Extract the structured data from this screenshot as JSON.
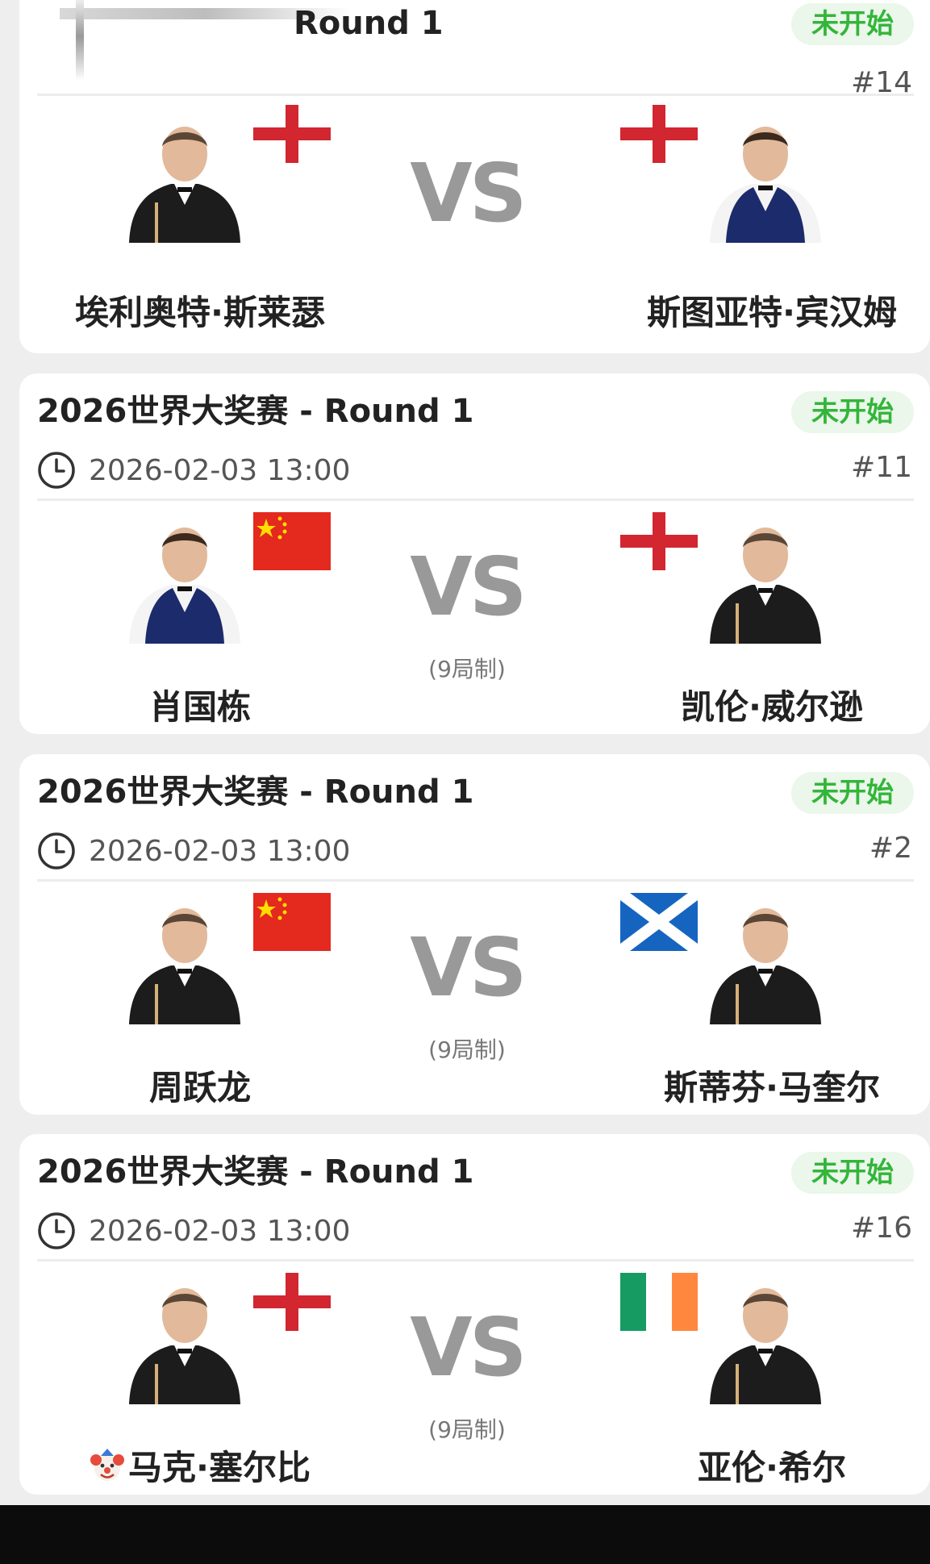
{
  "matches": [
    {
      "title": "Round 1",
      "status": "未开始",
      "number": "#14",
      "left": {
        "name": "埃利奥特·斯莱瑟",
        "flag": "england"
      },
      "right": {
        "name": "斯图亚特·宾汉姆",
        "flag": "england"
      },
      "vs": "VS"
    },
    {
      "title": "2026世界大奖赛 - Round 1",
      "status": "未开始",
      "time": "2026-02-03 13:00",
      "number": "#11",
      "format": "(9局制)",
      "left": {
        "name": "肖国栋",
        "flag": "china"
      },
      "right": {
        "name": "凯伦·威尔逊",
        "flag": "england"
      },
      "vs": "VS"
    },
    {
      "title": "2026世界大奖赛 - Round 1",
      "status": "未开始",
      "time": "2026-02-03 13:00",
      "number": "#2",
      "format": "(9局制)",
      "left": {
        "name": "周跃龙",
        "flag": "china"
      },
      "right": {
        "name": "斯蒂芬·马奎尔",
        "flag": "scotland"
      },
      "vs": "VS"
    },
    {
      "title": "2026世界大奖赛 - Round 1",
      "status": "未开始",
      "time": "2026-02-03 13:00",
      "number": "#16",
      "format": "(9局制)",
      "left": {
        "name": "马克·塞尔比",
        "flag": "england",
        "prefix_icon": "clown-emoji-icon"
      },
      "right": {
        "name": "亚伦·希尔",
        "flag": "ireland"
      },
      "vs": "VS"
    }
  ],
  "colors": {
    "status_text": "#34b53a",
    "status_bg": "#eaf7ea",
    "vs": "#999999"
  }
}
